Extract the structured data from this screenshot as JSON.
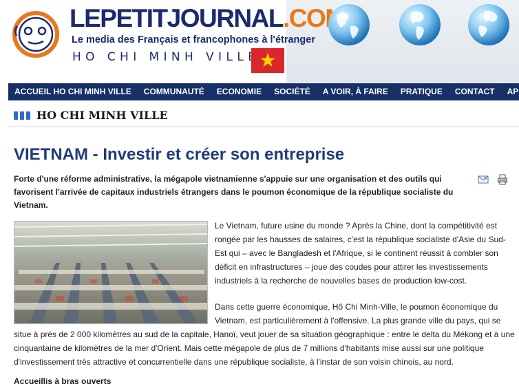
{
  "header": {
    "logo_title_main": "LEPETITJOURNAL",
    "logo_title_suffix": ".COM",
    "logo_tagline": "Le media des Français et francophones à l'étranger",
    "logo_city": "HO CHI MINH VILLE",
    "flag_star": "★"
  },
  "nav": {
    "items": [
      "ACCUEIL HO CHI MINH VILLE",
      "COMMUNAUTÉ",
      "ECONOMIE",
      "SOCIÉTÉ",
      "A VOIR, À FAIRE",
      "PRATIQUE",
      "CONTACT",
      "APPLICA"
    ]
  },
  "section": {
    "title": "HO CHI MINH VILLE"
  },
  "article": {
    "title": "VIETNAM - Investir et créer son entreprise",
    "lead": "Forte d'une réforme administrative, la mégapole vietnamienne s'appuie sur une organisation et des outils qui favorisent l'arrivée de capitaux industriels étrangers dans le poumon économique de la république socialiste du Vietnam.",
    "paragraph_1": "Le Vietnam, future usine du monde ? Après la Chine, dont la compétitivité est rongée par les hausses de salaires, c'est la république socialiste d'Asie du Sud-Est qui – avec le Bangladesh et l'Afrique, si le continent réussit à combler son déficit en infrastructures – joue des coudes pour attirer les investissements industriels à la recherche de nouvelles bases de production low-cost.",
    "paragraph_2": "Dans cette guerre économique, Hô Chi Minh-Ville, le poumon économique du Vietnam, est particulièrement à l'offensive. La plus grande ville du pays, qui se situe à près de 2 000 kilomètres au sud de la capitale, Hanoï, veut jouer de sa situation géographique : entre le delta du Mékong et à une cinquantaine de kilomètres de la mer d'Orient. Mais cette mégapole de plus de 7 millions d'habitants mise aussi sur une politique d'investissement très attractive et concurrentielle dans une république socialiste, à l'instar de son voisin chinois, au nord.",
    "subheading": "Accueillis à bras ouverts"
  },
  "icons": {
    "email": "email-icon",
    "print": "print-icon",
    "globes": [
      "globe-icon",
      "globe-icon",
      "globe-icon"
    ]
  },
  "colors": {
    "nav_bg": "#173068",
    "title_blue": "#1e3c78",
    "brand_orange": "#e9781c",
    "section_bars": "#2e6cc7",
    "flag_red": "#d8282a"
  }
}
